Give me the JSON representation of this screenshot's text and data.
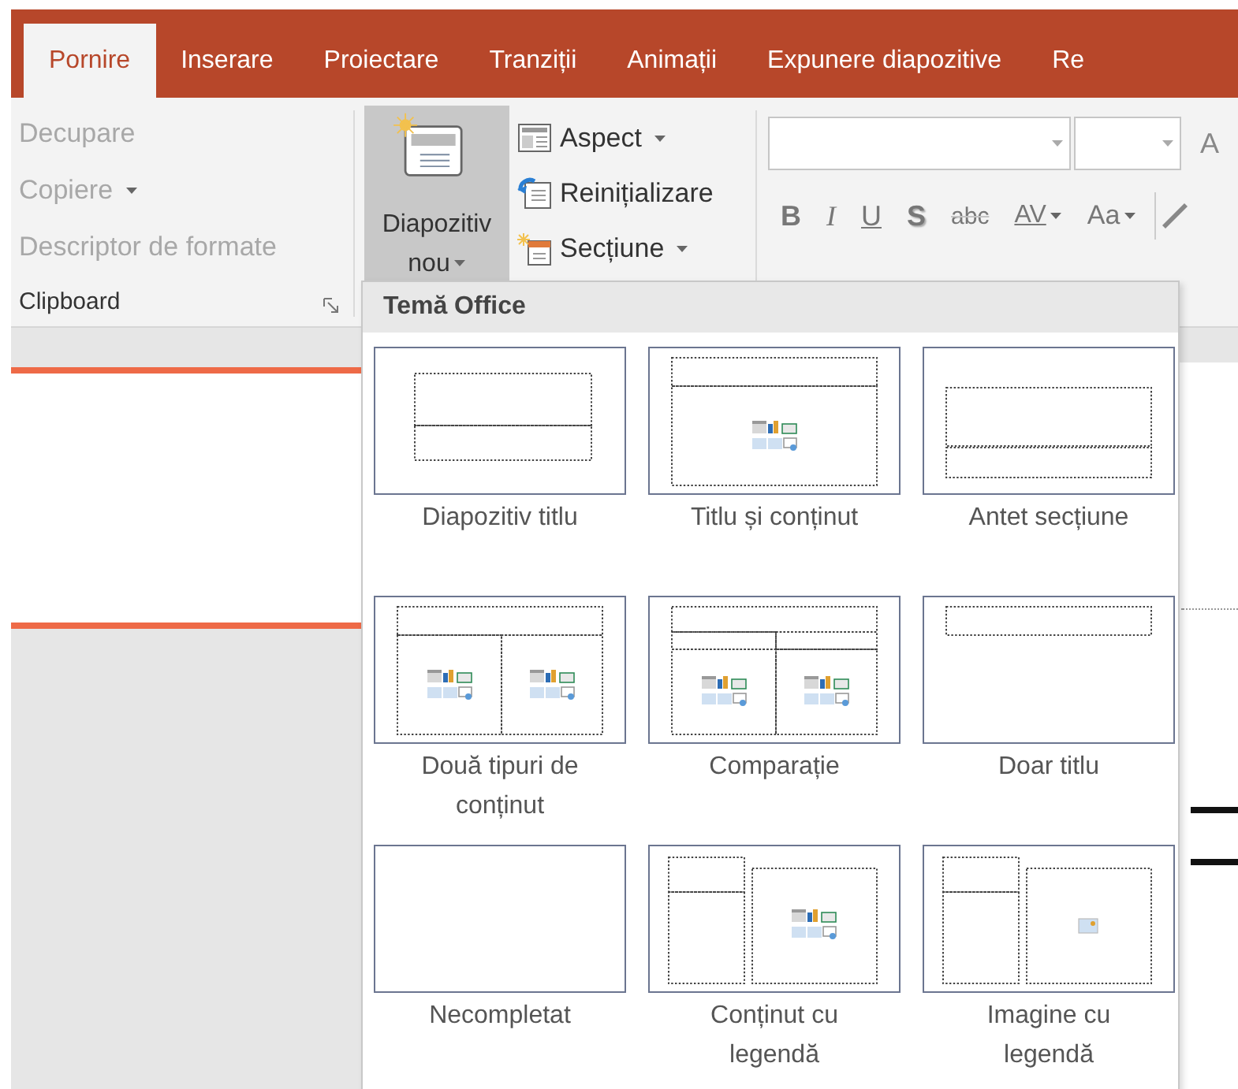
{
  "tabs": [
    {
      "label": "Pornire",
      "selected": true
    },
    {
      "label": "Inserare",
      "selected": false
    },
    {
      "label": "Proiectare",
      "selected": false
    },
    {
      "label": "Tranziții",
      "selected": false
    },
    {
      "label": "Animații",
      "selected": false
    },
    {
      "label": "Expunere diapozitive",
      "selected": false
    },
    {
      "label": "Re",
      "selected": false
    }
  ],
  "clipboard": {
    "items": [
      {
        "label": "Decupare",
        "disabled": true,
        "dropdown": false
      },
      {
        "label": "Copiere",
        "disabled": true,
        "dropdown": true
      },
      {
        "label": "Descriptor de formate",
        "disabled": true,
        "dropdown": false
      }
    ],
    "group_label": "Clipboard"
  },
  "slides": {
    "new_slide": {
      "label": "Diapozitiv nou",
      "expanded": true
    },
    "items": [
      {
        "label": "Aspect",
        "kind": "layout",
        "dropdown": true
      },
      {
        "label": "Reinițializare",
        "kind": "reset",
        "dropdown": false
      },
      {
        "label": "Secțiune",
        "kind": "section",
        "dropdown": true
      }
    ]
  },
  "font": {
    "grow_label": "A",
    "buttons": [
      {
        "label": "B",
        "kind": "bold",
        "dropdown": false
      },
      {
        "label": "I",
        "kind": "italic",
        "dropdown": false
      },
      {
        "label": "U",
        "kind": "underline",
        "dropdown": false
      },
      {
        "label": "S",
        "kind": "shadow",
        "dropdown": false
      },
      {
        "label": "abc",
        "kind": "strike",
        "dropdown": false
      },
      {
        "label": "AV",
        "kind": "spacing",
        "dropdown": true
      },
      {
        "label": "Aa",
        "kind": "case",
        "dropdown": true
      }
    ]
  },
  "layout_menu": {
    "title": "Temă Office",
    "layouts": [
      {
        "label": "Diapozitiv titlu",
        "kind": "title"
      },
      {
        "label": "Titlu și conținut",
        "kind": "title_content"
      },
      {
        "label": "Antet secțiune",
        "kind": "section_header"
      },
      {
        "label": "Două tipuri de conținut",
        "kind": "two_content"
      },
      {
        "label": "Comparație",
        "kind": "comparison"
      },
      {
        "label": "Doar titlu",
        "kind": "title_only"
      },
      {
        "label": "Necompletat",
        "kind": "blank"
      },
      {
        "label": "Conținut cu legendă",
        "kind": "content_caption"
      },
      {
        "label": "Imagine cu legendă",
        "kind": "picture_caption"
      }
    ]
  }
}
